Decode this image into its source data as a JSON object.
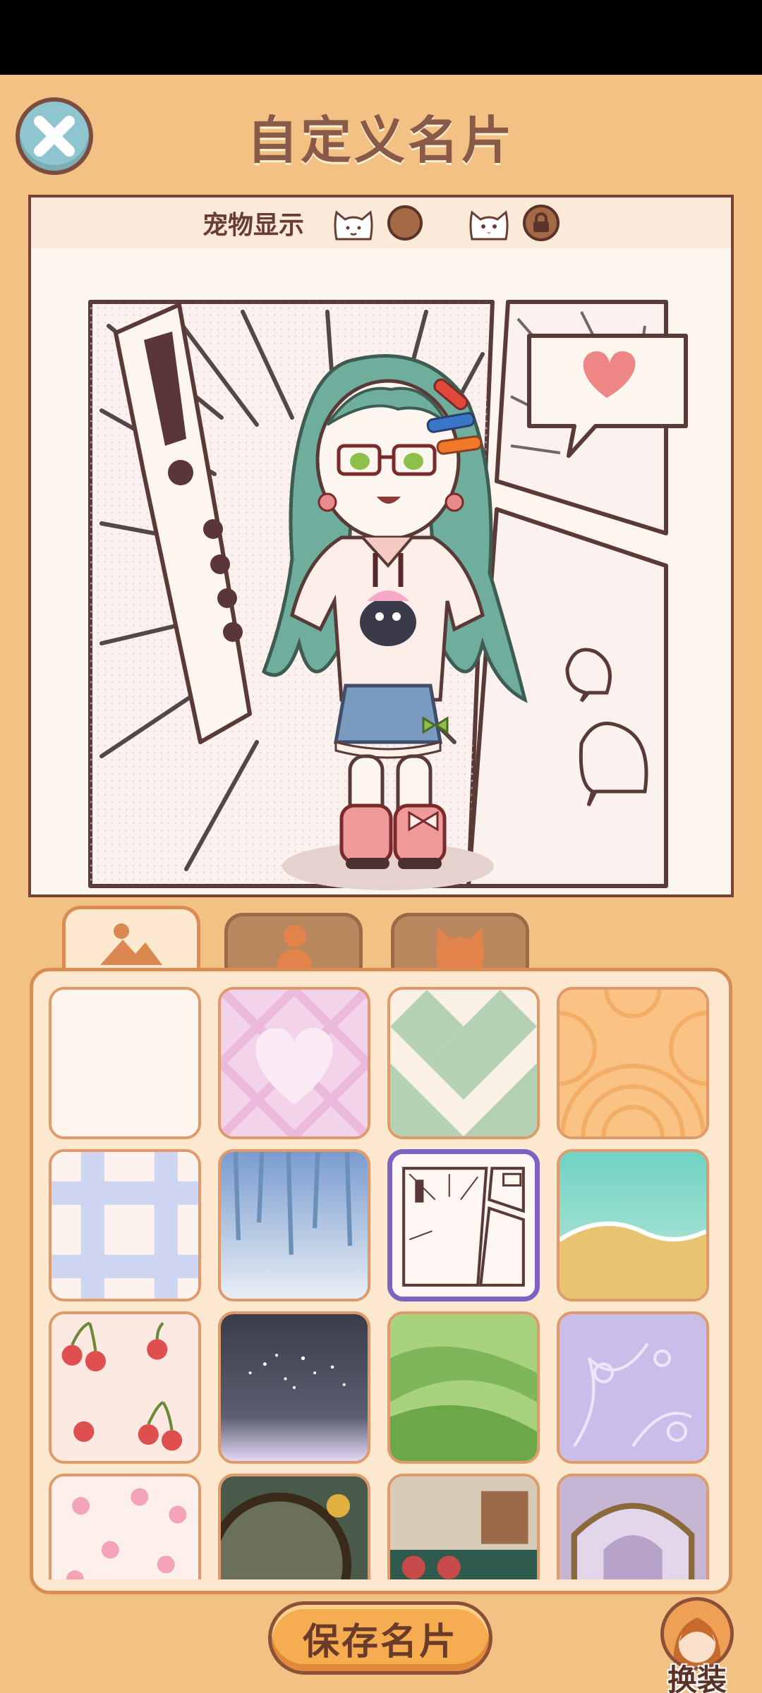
{
  "header": {
    "title": "自定义名片",
    "close_icon": "close-x-icon"
  },
  "card": {
    "pet_display_label": "宠物显示",
    "pet_options": [
      {
        "icon": "cat-outline-icon",
        "state": "selected"
      },
      {
        "icon": "cat-face-icon",
        "state": "locked"
      }
    ]
  },
  "tabs": [
    {
      "icon": "background-scene-icon",
      "active": true
    },
    {
      "icon": "character-icon",
      "active": false
    },
    {
      "icon": "cat-head-icon",
      "active": false
    }
  ],
  "backgrounds": [
    {
      "name": "plain-cream"
    },
    {
      "name": "pink-heart-plaid"
    },
    {
      "name": "green-diamond-check"
    },
    {
      "name": "orange-wave-pattern"
    },
    {
      "name": "blue-plaid"
    },
    {
      "name": "hanging-leaves"
    },
    {
      "name": "comic-panel",
      "selected": true
    },
    {
      "name": "beach-shore"
    },
    {
      "name": "cherry-pattern"
    },
    {
      "name": "starry-night"
    },
    {
      "name": "green-hills"
    },
    {
      "name": "lavender-floral"
    },
    {
      "name": "pink-blossom"
    },
    {
      "name": "autumn-window"
    },
    {
      "name": "cafe-interior"
    },
    {
      "name": "art-nouveau-arch"
    }
  ],
  "footer": {
    "save_label": "保存名片",
    "dressup_label": "换装"
  },
  "colors": {
    "background": "#f2c183",
    "title": "#8a5a48",
    "selected_border": "#7c62c2"
  }
}
